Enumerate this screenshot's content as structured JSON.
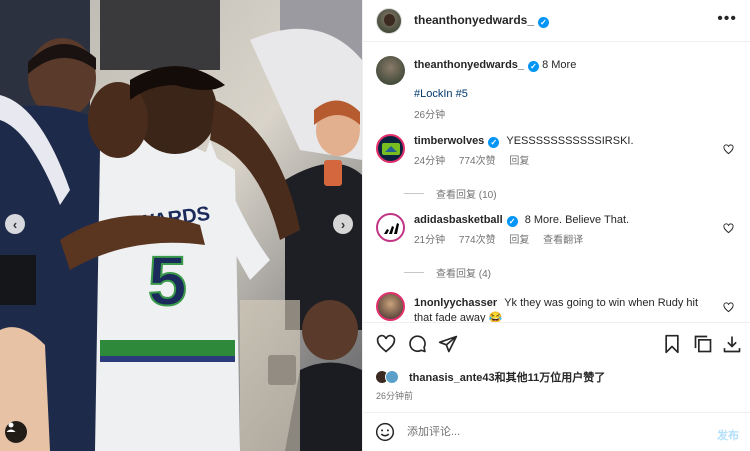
{
  "media": {
    "image_description_icon": "photo-of-players-hugging",
    "prev_icon": "chevron-left-icon",
    "next_icon": "chevron-right-icon",
    "tag_icon": "user-tag-icon",
    "jersey_text": "EDWARDS",
    "jersey_number": "5"
  },
  "header": {
    "username": "theanthonyedwards_",
    "verified_mark": "✓",
    "more": "•••"
  },
  "caption": {
    "username": "theanthonyedwards_",
    "verified_mark": "✓",
    "text": "8 More",
    "hashtags": "#LockIn #5",
    "time": "26分钟"
  },
  "comments": [
    {
      "username": "timberwolves",
      "verified_mark": "✓",
      "text": "YESSSSSSSSSSSIRSKI.",
      "time": "24分钟",
      "likes": "774次赞",
      "reply": "回复",
      "view_replies": "查看回复 (10)"
    },
    {
      "username": "adidasbasketball",
      "verified_mark": "✓",
      "text": "8 More. Believe That.",
      "time": "21分钟",
      "likes": "774次赞",
      "reply": "回复",
      "translate": "查看翻译",
      "view_replies": "查看回复 (4)"
    },
    {
      "username": "1nonlyychasser",
      "text": "Yk they was going to win when Rudy hit that fade away 😂"
    }
  ],
  "likes": {
    "user": "thanasis_ante43",
    "rest": "和其他11万位用户赞了"
  },
  "posted_time": "26分钟前",
  "composer": {
    "placeholder": "添加评论...",
    "post_label": "发布"
  },
  "colors": {
    "accent": "#0095f6",
    "link": "#00376b",
    "muted": "#737373"
  }
}
